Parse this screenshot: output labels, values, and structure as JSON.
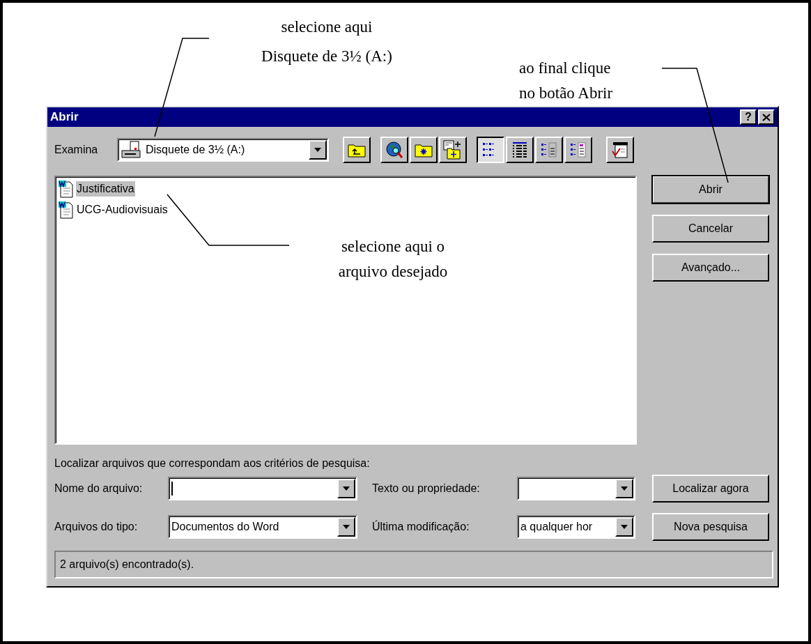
{
  "annotations": [
    {
      "lines": [
        "selecione aqui",
        "Disquete de 3½ (A:)"
      ]
    },
    {
      "lines": [
        "ao final clique",
        "no botão Abrir"
      ]
    },
    {
      "lines": [
        "selecione aqui o",
        "arquivo desejado"
      ]
    }
  ],
  "window": {
    "title": "Abrir",
    "help": "?"
  },
  "look_in": {
    "label": "Examina",
    "value": "Disquete de 3½ (A:)"
  },
  "toolbar": [
    {
      "kind": "up",
      "selected": false
    },
    {
      "kind": "web",
      "selected": false
    },
    {
      "kind": "favorites",
      "selected": false
    },
    {
      "kind": "add-favorite",
      "selected": false
    },
    {
      "kind": "list",
      "selected": true
    },
    {
      "kind": "details",
      "selected": false
    },
    {
      "kind": "properties",
      "selected": false
    },
    {
      "kind": "preview",
      "selected": false
    },
    {
      "kind": "commands",
      "selected": false
    }
  ],
  "files": [
    {
      "name": "Justificativa",
      "selected": true
    },
    {
      "name": "UCG-Audiovisuais",
      "selected": false
    }
  ],
  "buttons": [
    {
      "label": "Abrir",
      "default": true
    },
    {
      "label": "Cancelar",
      "default": false
    },
    {
      "label": "Avançado...",
      "default": false
    }
  ],
  "search": {
    "caption": "Localizar arquivos que correspondam aos critérios de pesquisa:",
    "fields": [
      {
        "label": "Nome do arquivo:",
        "focused": true
      },
      {
        "label": "Texto ou propriedade:",
        "focused": false
      },
      {
        "label": "Arquivos do tipo:",
        "value": "Documentos do Word",
        "focused": false
      },
      {
        "label": "Última modificação:",
        "value": "a qualquer hor",
        "focused": false
      }
    ],
    "buttons": [
      "Localizar agora",
      "Nova pesquisa"
    ]
  },
  "status_bar": "2 arquivo(s) encontrado(s)."
}
